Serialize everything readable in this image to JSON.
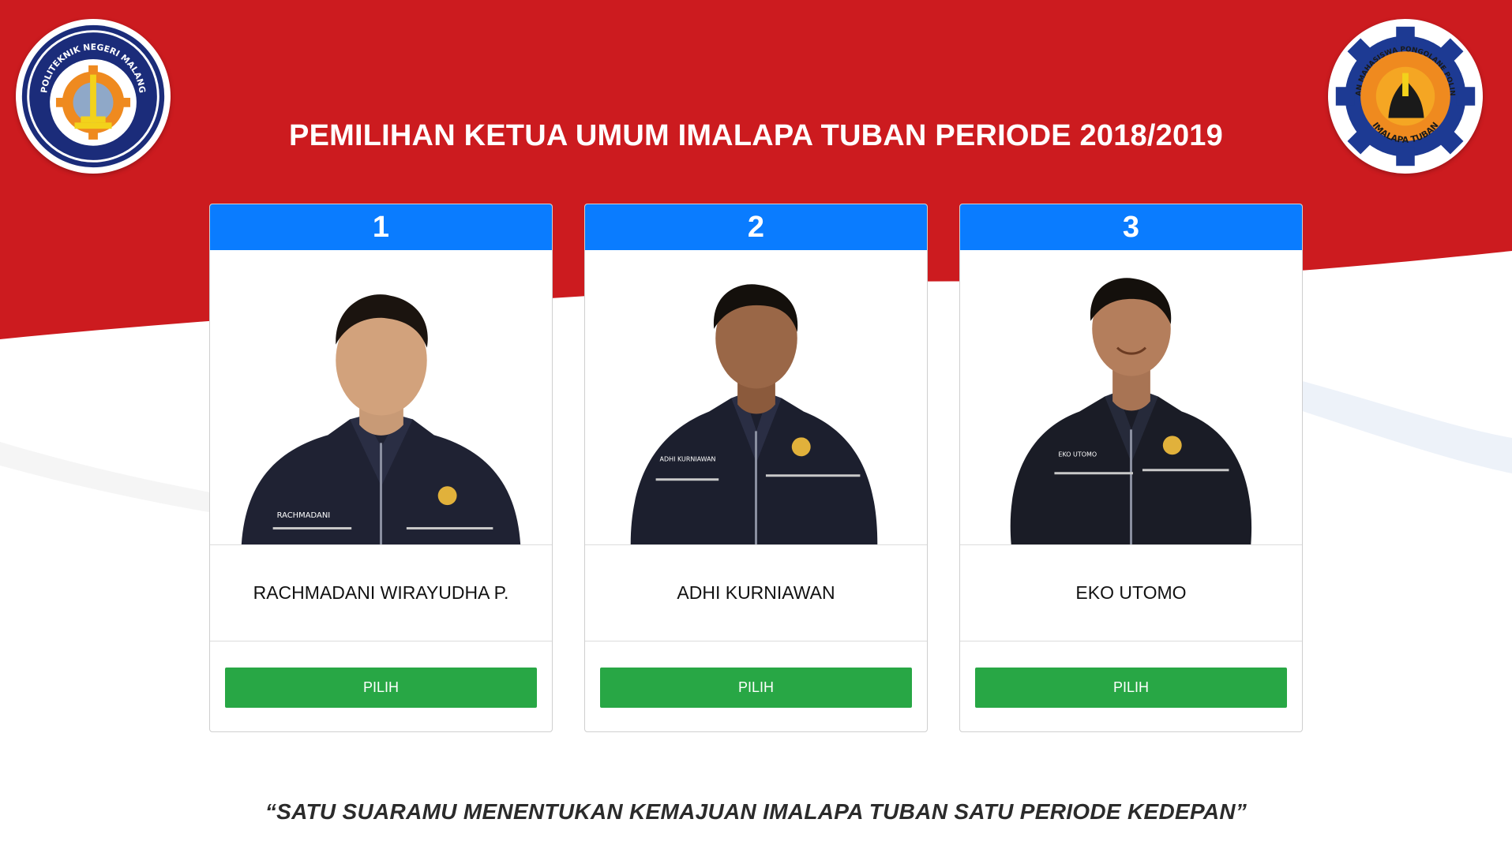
{
  "header": {
    "title": "PEMILIHAN KETUA UMUM IMALAPA TUBAN PERIODE 2018/2019",
    "logo_left_text": "POLITEKNIK NEGERI MALANG",
    "logo_right_text_top": "IKATAN MAHASISWA PONGOLANE POLINEMA",
    "logo_right_text_bottom": "IMALAPA TUBAN"
  },
  "candidates": [
    {
      "number": "1",
      "name": "RACHMADANI WIRAYUDHA P.",
      "jacket_label": "RACHMADANI",
      "button_label": "PILIH"
    },
    {
      "number": "2",
      "name": "ADHI KURNIAWAN",
      "jacket_label": "ADHI KURNIAWAN",
      "button_label": "PILIH"
    },
    {
      "number": "3",
      "name": "EKO UTOMO",
      "jacket_label": "EKO UTOMO",
      "button_label": "PILIH"
    }
  ],
  "footer": {
    "slogan": "“SATU SUARAMU MENENTUKAN KEMAJUAN IMALAPA TUBAN SATU PERIODE KEDEPAN”"
  },
  "colors": {
    "flag_red": "#cc1b1f",
    "card_header_blue": "#0a7cff",
    "button_green": "#28a745"
  }
}
